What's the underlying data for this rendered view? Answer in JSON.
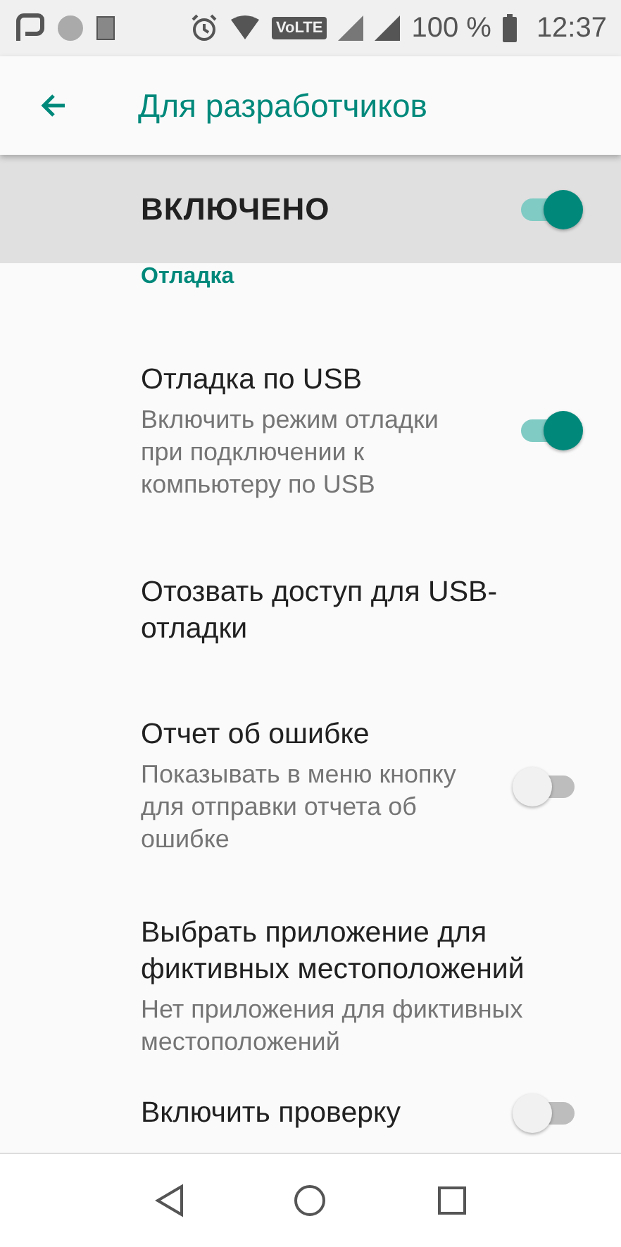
{
  "status_bar": {
    "volte": "VoLTE",
    "battery": "100 %",
    "time": "12:37"
  },
  "toolbar": {
    "title": "Для разработчиков"
  },
  "master": {
    "label": "ВКЛЮЧЕНО",
    "on": true
  },
  "section": "Отладка",
  "items": [
    {
      "kind": "switch",
      "title": "Отладка по USB",
      "summary": "Включить режим отладки при подключении к компьютеру по USB",
      "on": true
    },
    {
      "kind": "plain",
      "title": "Отозвать доступ для USB-отладки"
    },
    {
      "kind": "switch",
      "title": "Отчет об ошибке",
      "summary": "Показывать в меню кнопку для отправки отчета об ошибке",
      "on": false
    },
    {
      "kind": "plain",
      "title": "Выбрать приложение для фиктивных местоположений",
      "summary": "Нет приложения для фиктивных местоположений"
    },
    {
      "kind": "switch",
      "title": "Включить проверку",
      "on": false
    }
  ]
}
